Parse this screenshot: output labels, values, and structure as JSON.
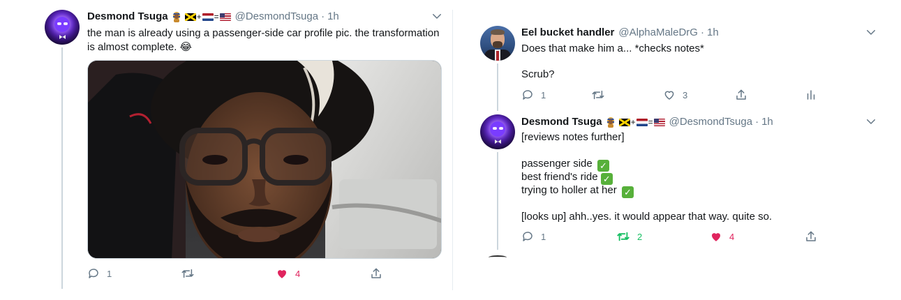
{
  "left_tweet": {
    "author_name": "Desmond Tsuga",
    "handle": "@DesmondTsuga",
    "time": "1h",
    "text_line1": "the man is already using a passenger-side car profile pic.  the transformation",
    "text_line2": "is almost complete. 😂",
    "emoji_pharaoh": "🗿",
    "flags": [
      "jamaica-flag",
      "netherlands-flag",
      "usa-flag"
    ],
    "op_plus": "+",
    "op_eq": "=",
    "actions": {
      "reply_count": "1",
      "retweet_count": "",
      "like_count": "4"
    },
    "colors": {
      "like": "#e0245e",
      "retweet": "#17bf63",
      "muted": "#657786"
    }
  },
  "reply_tweet": {
    "author_name": "Eel bucket handler",
    "handle": "@AlphaMaleDrG",
    "time": "1h",
    "text_line1": "Does that make him a... *checks notes*",
    "text_line2": "Scrub?",
    "actions": {
      "reply_count": "1",
      "retweet_count": "",
      "like_count": "3"
    }
  },
  "second_reply": {
    "author_name": "Desmond Tsuga",
    "handle": "@DesmondTsuga",
    "time": "1h",
    "op_plus": "+",
    "op_eq": "=",
    "line1": "[reviews notes further]",
    "line2": "passenger side",
    "line3": "best friend's ride",
    "line4": "trying to holler at her",
    "line5": "[looks up] ahh..yes.  it would appear that way. quite so.",
    "actions": {
      "reply_count": "1",
      "retweet_count": "2",
      "like_count": "4"
    }
  },
  "separator": "·"
}
